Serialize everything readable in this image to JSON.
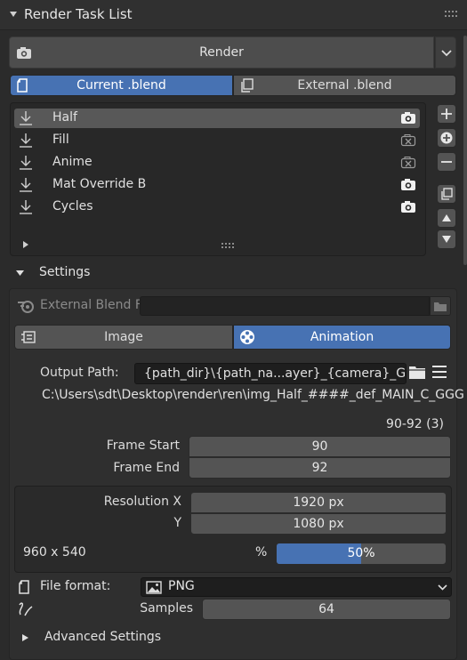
{
  "panel": {
    "title": "Render Task List"
  },
  "render": {
    "label": "Render"
  },
  "source_tabs": [
    {
      "label": "Current .blend",
      "active": true
    },
    {
      "label": "External .blend",
      "active": false
    }
  ],
  "tasks": [
    {
      "name": "Half",
      "selected": true,
      "camera": "camera-icon"
    },
    {
      "name": "Fill",
      "selected": false,
      "camera": "camera-disabled-icon"
    },
    {
      "name": "Anime",
      "selected": false,
      "camera": "camera-disabled-icon"
    },
    {
      "name": "Mat Override B",
      "selected": false,
      "camera": "camera-icon"
    },
    {
      "name": "Cycles",
      "selected": false,
      "camera": "camera-icon"
    }
  ],
  "settings": {
    "title": "Settings",
    "external_blend_label": "External Blend F",
    "external_blend_value": "",
    "mode_tabs": [
      {
        "label": "Image",
        "active": false
      },
      {
        "label": "Animation",
        "active": true
      }
    ],
    "output_path_label": "Output Path:",
    "output_path_value": "{path_dir}\\{path_na...ayer}_{camera}_GGG",
    "output_path_resolved": "C:\\Users\\sdt\\Desktop\\render\\ren\\img_Half_####_def_MAIN_C_GGG",
    "frame_range_text": "90-92 (3)",
    "frame_start_label": "Frame Start",
    "frame_start_value": "90",
    "frame_end_label": "Frame End",
    "frame_end_value": "92",
    "resolution_x_label": "Resolution X",
    "resolution_x_value": "1920 px",
    "resolution_y_label": "Y",
    "resolution_y_value": "1080 px",
    "scaled_resolution": "960 x 540",
    "percent_label": "%",
    "percent_value": "50%",
    "percent_fraction": 0.5,
    "file_format_label": "File format:",
    "file_format_value": "PNG",
    "samples_label": "Samples",
    "samples_value": "64",
    "advanced_label": "Advanced Settings"
  },
  "colors": {
    "accent": "#4772b3",
    "panel": "#2b2b2b",
    "field": "#545454"
  }
}
